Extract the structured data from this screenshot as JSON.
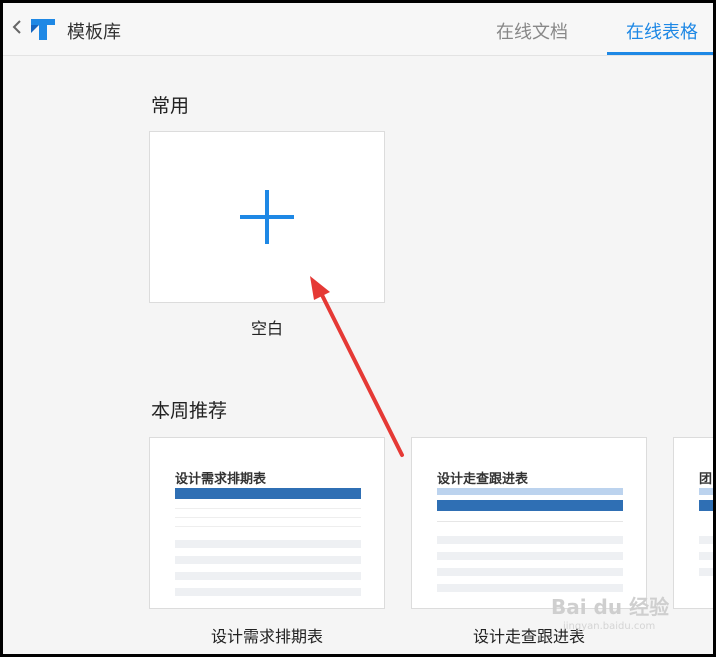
{
  "header": {
    "back_icon": "chevron-left-icon",
    "logo_icon": "tencent-docs-logo",
    "title": "模板库",
    "tabs": [
      {
        "label": "在线文档",
        "active": false
      },
      {
        "label": "在线表格",
        "active": true
      }
    ],
    "accent_color": "#1e88e5"
  },
  "sections": {
    "common": {
      "title": "常用",
      "blank_card": {
        "icon": "plus-icon",
        "caption": "空白"
      }
    },
    "weekly": {
      "title": "本周推荐",
      "cards": [
        {
          "thumb_title": "设计需求排期表",
          "caption": "设计需求排期表"
        },
        {
          "thumb_title": "设计走查跟进表",
          "caption": "设计走查跟进表"
        },
        {
          "thumb_title": "团",
          "caption": ""
        }
      ]
    }
  },
  "annotation": {
    "arrow_color": "#e53935"
  },
  "watermark": {
    "text": "Bai du 经验",
    "url": "jingyan.baidu.com"
  }
}
